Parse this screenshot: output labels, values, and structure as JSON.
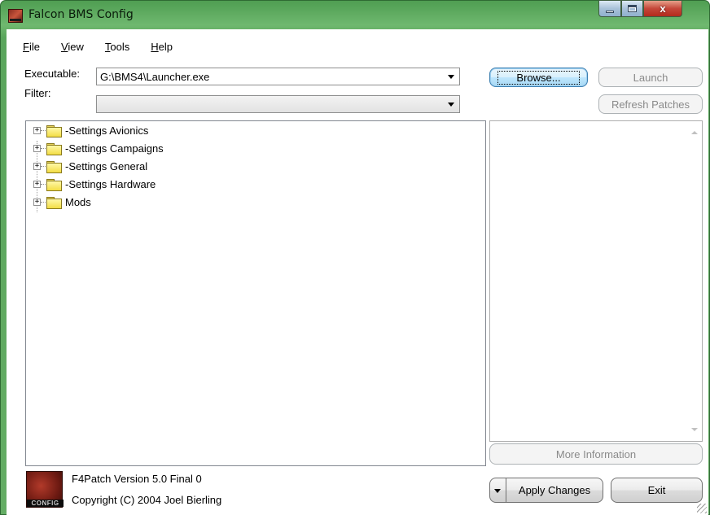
{
  "window": {
    "title": "Falcon BMS Config",
    "minimize_icon": "minimize-icon",
    "maximize_icon": "maximize-icon",
    "close_glyph": "x"
  },
  "menu": {
    "items": [
      {
        "key": "F",
        "rest": "ile"
      },
      {
        "key": "V",
        "rest": "iew"
      },
      {
        "key": "T",
        "rest": "ools"
      },
      {
        "key": "H",
        "rest": "elp"
      }
    ]
  },
  "executable": {
    "label": "Executable:",
    "value": "G:\\BMS4\\Launcher.exe"
  },
  "filter": {
    "label": "Filter:",
    "value": ""
  },
  "buttons": {
    "browse": "Browse...",
    "launch": "Launch",
    "refresh": "Refresh Patches",
    "more_info": "More Information",
    "apply": "Apply Changes",
    "exit": "Exit"
  },
  "tree": {
    "items": [
      {
        "label": "-Settings Avionics"
      },
      {
        "label": "-Settings Campaigns"
      },
      {
        "label": "-Settings General"
      },
      {
        "label": "-Settings Hardware"
      },
      {
        "label": "Mods"
      }
    ]
  },
  "footer": {
    "version": "F4Patch Version  5.0 Final 0",
    "copyright": "Copyright (C) 2004 Joel Bierling",
    "logo_text": "CONFIG"
  },
  "colors": {
    "frame": "#5aa55c",
    "close_button": "#c5473a",
    "folder": "#f3dd45"
  }
}
